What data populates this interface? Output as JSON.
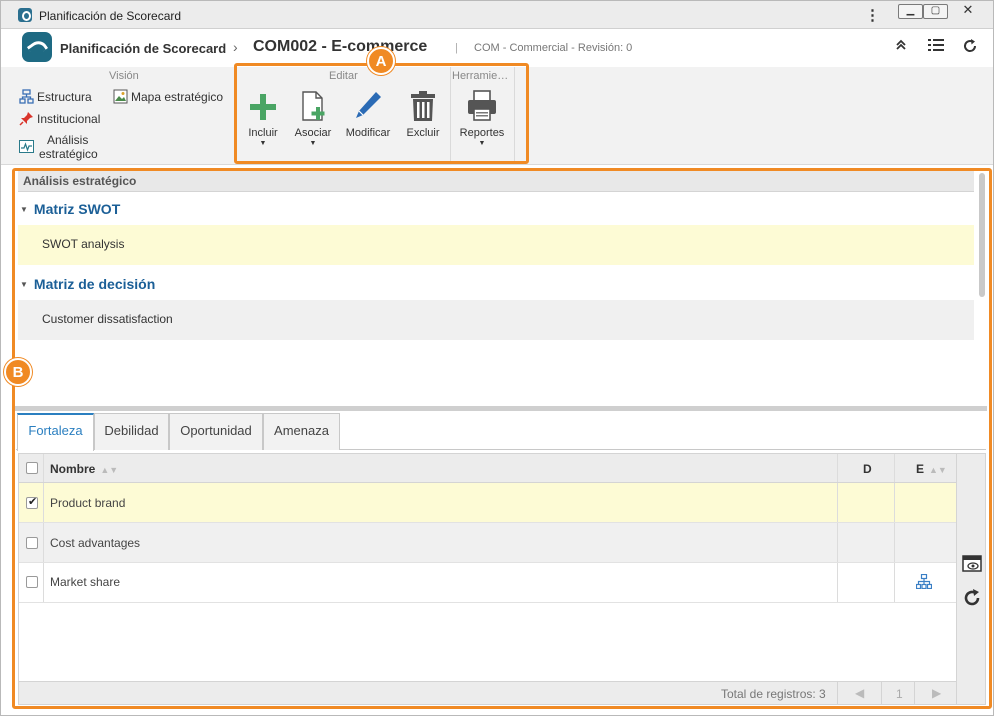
{
  "window": {
    "title": "Planificación de Scorecard",
    "menu_icon": "kebab-menu-icon"
  },
  "header": {
    "app_name": "Planificación de Scorecard",
    "separator": "›",
    "record": "COM002 - E-commerce",
    "pipe": "|",
    "meta": "COM - Commercial - Revisión: 0"
  },
  "ribbon": {
    "groups": {
      "vision": "Visión",
      "editar": "Editar",
      "herramientas": "Herramie…"
    },
    "vision_items": [
      {
        "label": "Estructura",
        "icon": "structure-icon"
      },
      {
        "label": "Mapa estratégico",
        "icon": "map-icon"
      },
      {
        "label": "Institucional",
        "icon": "pin-icon"
      },
      {
        "label": "Análisis",
        "icon": "chart-icon"
      },
      {
        "label": "estratégico",
        "icon": ""
      }
    ],
    "buttons": [
      {
        "label": "Incluir",
        "icon": "plus-icon"
      },
      {
        "label": "Asociar",
        "icon": "associate-icon"
      },
      {
        "label": "Modificar",
        "icon": "pencil-icon"
      },
      {
        "label": "Excluir",
        "icon": "trash-icon"
      },
      {
        "label": "Reportes",
        "icon": "printer-icon"
      }
    ]
  },
  "callouts": {
    "a": "A",
    "b": "B"
  },
  "analysis": {
    "section_title": "Análisis estratégico",
    "groups": [
      {
        "title": "Matriz SWOT",
        "items": [
          "SWOT analysis"
        ]
      },
      {
        "title": "Matriz de decisión",
        "items": [
          "Customer dissatisfaction"
        ]
      }
    ]
  },
  "tabs": [
    "Fortaleza",
    "Debilidad",
    "Oportunidad",
    "Amenaza"
  ],
  "grid": {
    "columns": {
      "nombre": "Nombre",
      "d": "D",
      "e": "E"
    },
    "rows": [
      {
        "nombre": "Product brand",
        "checked": true
      },
      {
        "nombre": "Cost advantages",
        "checked": false
      },
      {
        "nombre": "Market share",
        "checked": false,
        "e_icon": "hierarchy-icon"
      }
    ],
    "footer": {
      "total": "Total de registros: 3",
      "page": "1"
    }
  },
  "colors": {
    "accent": "#2b7fc0",
    "callout": "#f08a24",
    "selected_row": "#fdfbd5",
    "title_blue": "#1b5f97"
  }
}
